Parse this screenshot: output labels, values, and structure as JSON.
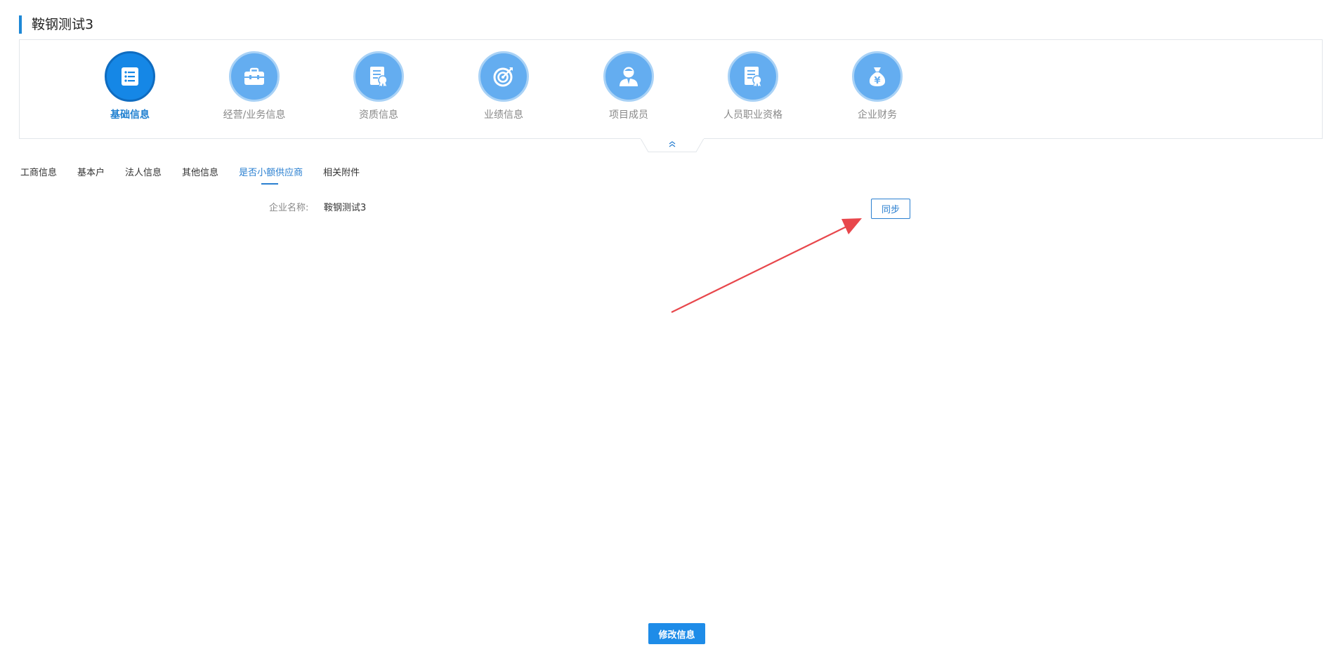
{
  "page": {
    "title": "鞍钢测试3"
  },
  "nav": {
    "items": [
      {
        "label": "基础信息",
        "icon": "list-icon",
        "active": true
      },
      {
        "label": "经营/业务信息",
        "icon": "briefcase-icon",
        "active": false
      },
      {
        "label": "资质信息",
        "icon": "certificate-icon",
        "active": false
      },
      {
        "label": "业绩信息",
        "icon": "target-icon",
        "active": false
      },
      {
        "label": "项目成员",
        "icon": "person-icon",
        "active": false
      },
      {
        "label": "人员职业资格",
        "icon": "certificate-icon",
        "active": false
      },
      {
        "label": "企业财务",
        "icon": "money-bag-icon",
        "active": false
      }
    ],
    "collapse_icon": "double-chevron-up-icon"
  },
  "subtabs": {
    "items": [
      {
        "label": "工商信息",
        "active": false
      },
      {
        "label": "基本户",
        "active": false
      },
      {
        "label": "法人信息",
        "active": false
      },
      {
        "label": "其他信息",
        "active": false
      },
      {
        "label": "是否小额供应商",
        "active": true
      },
      {
        "label": "相关附件",
        "active": false
      }
    ]
  },
  "form": {
    "company_name_label": "企业名称:",
    "company_name_value": "鞍钢测试3",
    "sync_label": "同步"
  },
  "footer": {
    "edit_label": "修改信息"
  },
  "colors": {
    "accent": "#1e88d6",
    "icon_bg": "#64adf0",
    "annotation_arrow": "#e8474c"
  }
}
